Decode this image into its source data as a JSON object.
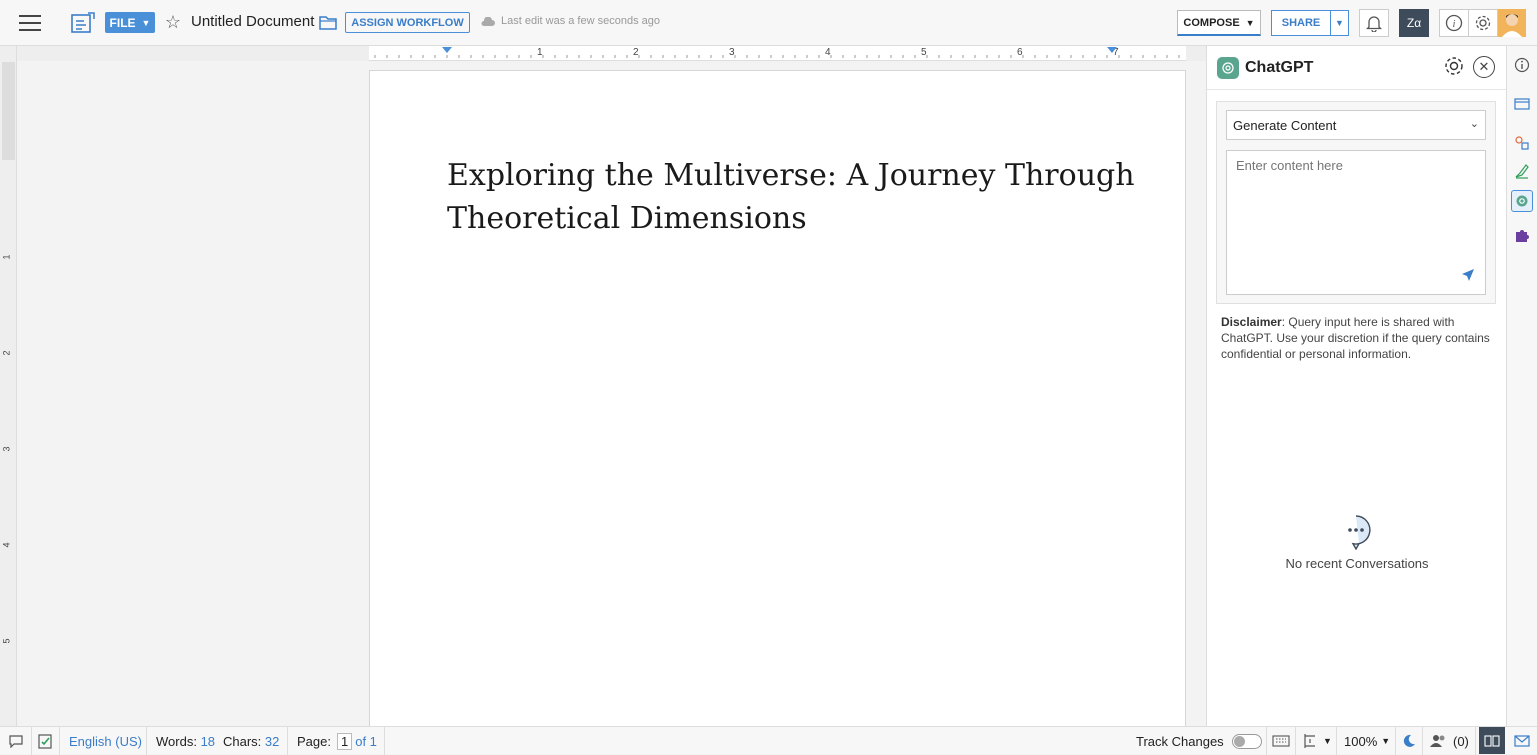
{
  "topbar": {
    "file_label": "FILE",
    "doc_title": "Untitled Document",
    "assign_label": "ASSIGN WORKFLOW",
    "last_edit": "Last edit was a few seconds ago",
    "compose_label": "COMPOSE",
    "share_label": "SHARE"
  },
  "ruler": {
    "h_numbers": [
      "1",
      "2",
      "3",
      "4",
      "5",
      "6",
      "7"
    ],
    "v_numbers": [
      "1",
      "2",
      "3",
      "4",
      "5"
    ]
  },
  "document": {
    "heading": "Exploring the Multiverse: A Journey Through Theoretical Dimensions"
  },
  "panel": {
    "title": "ChatGPT",
    "mode_selected": "Generate Content",
    "input_placeholder": "Enter content here",
    "disclaimer_label": "Disclaimer",
    "disclaimer_text": ": Query input here is shared with ChatGPT. Use your discretion if the query contains confidential or personal information.",
    "empty_state": "No recent Conversations"
  },
  "status": {
    "language": "English (US)",
    "words_label": "Words:",
    "words_value": "18",
    "chars_label": "Chars:",
    "chars_value": "32",
    "page_label": "Page:",
    "page_current": "1",
    "page_of": "of 1",
    "track_changes": "Track Changes",
    "zoom": "100%",
    "collaborators": "(0)"
  },
  "colors": {
    "accent": "#4a90d9",
    "chatgpt_brand": "#5aa58e"
  }
}
